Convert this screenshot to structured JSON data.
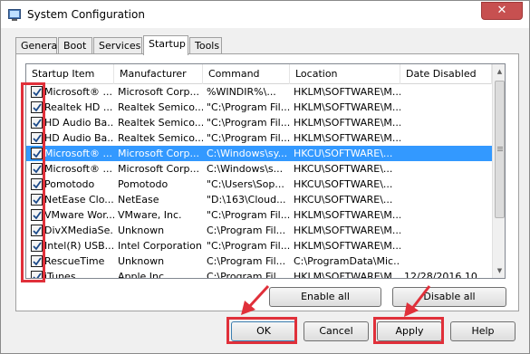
{
  "window": {
    "title": "System Configuration",
    "close_glyph": "✕"
  },
  "tabs": [
    {
      "label": "General"
    },
    {
      "label": "Boot"
    },
    {
      "label": "Services"
    },
    {
      "label": "Startup",
      "active": true
    },
    {
      "label": "Tools"
    }
  ],
  "columns": [
    {
      "label": "Startup Item"
    },
    {
      "label": "Manufacturer"
    },
    {
      "label": "Command"
    },
    {
      "label": "Location"
    },
    {
      "label": "Date Disabled"
    }
  ],
  "rows": [
    {
      "checked": true,
      "item": "Microsoft® ...",
      "manufacturer": "Microsoft Corp...",
      "command": "%WINDIR%\\...",
      "location": "HKLM\\SOFTWARE\\M...",
      "date": ""
    },
    {
      "checked": true,
      "item": "Realtek HD ...",
      "manufacturer": "Realtek Semico...",
      "command": "\"C:\\Program Fil...",
      "location": "HKLM\\SOFTWARE\\M...",
      "date": ""
    },
    {
      "checked": true,
      "item": "HD Audio Ba...",
      "manufacturer": "Realtek Semico...",
      "command": "\"C:\\Program Fil...",
      "location": "HKLM\\SOFTWARE\\M...",
      "date": ""
    },
    {
      "checked": true,
      "item": "HD Audio Ba...",
      "manufacturer": "Realtek Semico...",
      "command": "\"C:\\Program Fil...",
      "location": "HKLM\\SOFTWARE\\M...",
      "date": ""
    },
    {
      "checked": true,
      "item": "Microsoft® ...",
      "manufacturer": "Microsoft Corp...",
      "command": "C:\\Windows\\sy...",
      "location": "HKCU\\SOFTWARE\\...",
      "date": "",
      "selected": true
    },
    {
      "checked": true,
      "item": "Microsoft® ...",
      "manufacturer": "Microsoft Corp...",
      "command": "C:\\Windows\\s...",
      "location": "HKCU\\SOFTWARE\\...",
      "date": ""
    },
    {
      "checked": true,
      "item": "Pomotodo",
      "manufacturer": "Pomotodo",
      "command": "\"C:\\Users\\Sop...",
      "location": "HKCU\\SOFTWARE\\...",
      "date": ""
    },
    {
      "checked": true,
      "item": "NetEase Clo...",
      "manufacturer": "NetEase",
      "command": "\"D:\\163\\Cloud...",
      "location": "HKCU\\SOFTWARE\\...",
      "date": ""
    },
    {
      "checked": true,
      "item": "VMware Wor...",
      "manufacturer": "VMware, Inc.",
      "command": "\"C:\\Program Fil...",
      "location": "HKLM\\SOFTWARE\\M...",
      "date": ""
    },
    {
      "checked": true,
      "item": "DivXMediaSe...",
      "manufacturer": "Unknown",
      "command": "C:\\Program Fil...",
      "location": "HKLM\\SOFTWARE\\M...",
      "date": ""
    },
    {
      "checked": true,
      "item": "Intel(R) USB...",
      "manufacturer": "Intel Corporation",
      "command": "\"C:\\Program Fil...",
      "location": "HKLM\\SOFTWARE\\M...",
      "date": ""
    },
    {
      "checked": true,
      "item": "RescueTime",
      "manufacturer": "Unknown",
      "command": "C:\\Program Fil...",
      "location": "C:\\ProgramData\\Mic...",
      "date": ""
    },
    {
      "checked": true,
      "item": "iTunes",
      "manufacturer": "Apple Inc.",
      "command": "C:\\Program Fil...",
      "location": "HKLM\\SOFTWARE\\M...",
      "date": "12/28/2016 10..."
    }
  ],
  "buttons": {
    "enable_all": "Enable all",
    "disable_all": "Disable all",
    "ok": "OK",
    "cancel": "Cancel",
    "apply": "Apply",
    "help": "Help"
  },
  "colors": {
    "selection": "#3399ff",
    "highlight_annotation": "#e0303a",
    "close_button": "#c75050"
  }
}
